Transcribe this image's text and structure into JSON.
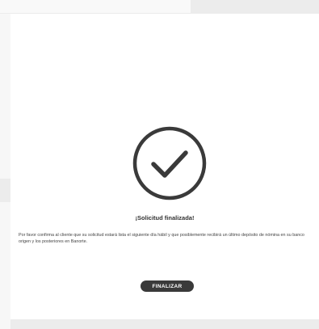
{
  "dialog": {
    "icon": "checkmark-circle-icon",
    "title": "¡Solicitud finalizada!",
    "message": "Por favor confirma al cliente que su solicitud estará lista el siguiente día hábil y que posiblemente recibirá un último depósito de nómina en su banco origen y los posteriores en Banorte.",
    "finish_label": "FINALIZAR"
  },
  "colors": {
    "icon_stroke": "#3a3a3a",
    "button_bg": "#3a3a3a",
    "card_bg": "#ffffff",
    "page_bg": "#ececec"
  }
}
